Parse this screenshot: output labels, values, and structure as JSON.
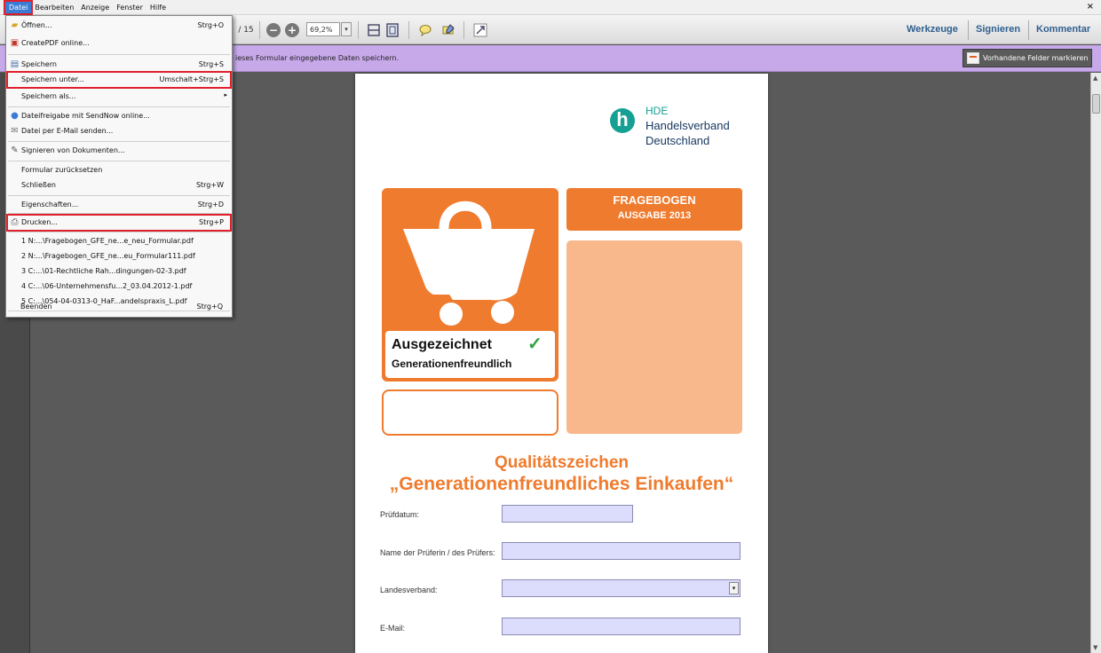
{
  "menubar": {
    "items": [
      "Datei",
      "Bearbeiten",
      "Anzeige",
      "Fenster",
      "Hilfe"
    ],
    "close": "×"
  },
  "toolbar": {
    "page_total": "/ 15",
    "zoom": "69,2%",
    "zoom_out": "−",
    "zoom_in": "+",
    "tools": "Werkzeuge",
    "sign": "Signieren",
    "comment": "Kommentar"
  },
  "purplebar": {
    "message": "ieses Formular eingegebene Daten speichern.",
    "mark_fields": "Vorhandene Felder markieren"
  },
  "file_menu": {
    "items": [
      {
        "label": "Öffnen...",
        "shortcut": "Strg+O",
        "icon": "open-folder-icon"
      },
      {
        "label": "CreatePDF online...",
        "shortcut": "",
        "icon": "createpdf-icon"
      },
      {
        "label": "Speichern",
        "shortcut": "Strg+S",
        "icon": "save-icon"
      },
      {
        "label": "Speichern unter...",
        "shortcut": "Umschalt+Strg+S",
        "icon": ""
      },
      {
        "label": "Speichern als...",
        "shortcut": "",
        "icon": ""
      },
      {
        "label": "Dateifreigabe mit SendNow online...",
        "shortcut": "",
        "icon": "sendnow-icon"
      },
      {
        "label": "Datei per E-Mail senden...",
        "shortcut": "",
        "icon": "email-icon"
      },
      {
        "label": "Signieren von Dokumenten...",
        "shortcut": "",
        "icon": "sign-icon"
      },
      {
        "label": "Formular zurücksetzen",
        "shortcut": "",
        "icon": ""
      },
      {
        "label": "Schließen",
        "shortcut": "Strg+W",
        "icon": ""
      },
      {
        "label": "Eigenschaften...",
        "shortcut": "Strg+D",
        "icon": ""
      },
      {
        "label": "Drucken...",
        "shortcut": "Strg+P",
        "icon": "print-icon"
      },
      {
        "label": "1 N:...\\Fragebogen_GFE_ne...e_neu_Formular.pdf",
        "shortcut": "",
        "icon": ""
      },
      {
        "label": "2 N:...\\Fragebogen_GFE_ne...eu_Formular111.pdf",
        "shortcut": "",
        "icon": ""
      },
      {
        "label": "3 C:...\\01-Rechtliche Rah...dingungen-02-3.pdf",
        "shortcut": "",
        "icon": ""
      },
      {
        "label": "4 C:...\\06-Unternehmensfu...2_03.04.2012-1.pdf",
        "shortcut": "",
        "icon": ""
      },
      {
        "label": "5 C:...\\054-04-0313-0_HaF...andelspraxis_L.pdf",
        "shortcut": "",
        "icon": ""
      },
      {
        "label": "Beenden",
        "shortcut": "Strg+Q",
        "icon": ""
      }
    ]
  },
  "document": {
    "logo": {
      "mark": "h",
      "line1": "HDE",
      "line2": "Handelsverband",
      "line3": "Deutschland"
    },
    "cert_line1": "Ausgezeichnet",
    "cert_check": "✓",
    "cert_line2": "Generationenfreundlich",
    "frage_line1": "FRAGEBOGEN",
    "frage_line2": "AUSGABE 2013",
    "title_line1": "Qualitätszeichen",
    "title_line2": "„Generationenfreundliches Einkaufen“",
    "fields": {
      "pruefdatum": "Prüfdatum:",
      "name": "Name der Prüferin / des Prüfers:",
      "landesverband": "Landesverband:",
      "email": "E-Mail:"
    }
  },
  "colors": {
    "orange": "#ef7b2e",
    "peach": "#f8b88b",
    "hde_teal": "#16a093",
    "hde_navy": "#16365f",
    "purple_bar": "#c7a9ea",
    "highlight_red": "#e0202a",
    "field_fill": "#dcdcfc"
  }
}
